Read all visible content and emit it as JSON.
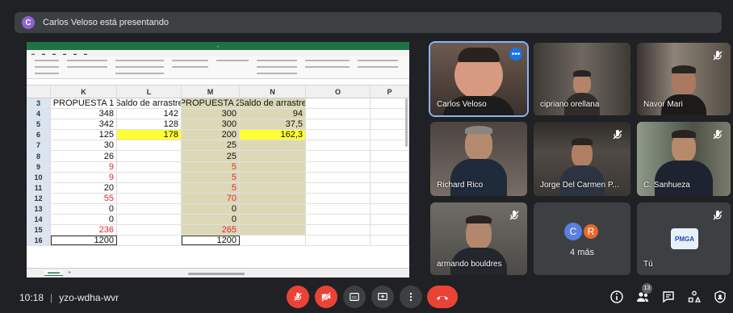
{
  "banner": {
    "avatar_letter": "C",
    "text": "Carlos Veloso está presentando"
  },
  "excel": {
    "columns": [
      "K",
      "L",
      "M",
      "N",
      "O",
      "P"
    ],
    "rows": [
      {
        "n": "3",
        "k": "PROPUESTA 1",
        "l": "Saldo de arrastre",
        "m": "PROPUESTA 2",
        "n2": "Saldo de arrastre"
      },
      {
        "n": "4",
        "k": "348",
        "l": "142",
        "m": "300",
        "n2": "94"
      },
      {
        "n": "5",
        "k": "342",
        "l": "128",
        "m": "300",
        "n2": "37,5"
      },
      {
        "n": "6",
        "k": "125",
        "l": "178",
        "m": "200",
        "n2": "162,3"
      },
      {
        "n": "7",
        "k": "30",
        "l": "",
        "m": "25",
        "n2": ""
      },
      {
        "n": "8",
        "k": "26",
        "l": "",
        "m": "25",
        "n2": ""
      },
      {
        "n": "9",
        "k": "9",
        "l": "",
        "m": "5",
        "n2": ""
      },
      {
        "n": "10",
        "k": "9",
        "l": "",
        "m": "5",
        "n2": ""
      },
      {
        "n": "11",
        "k": "20",
        "l": "",
        "m": "5",
        "n2": ""
      },
      {
        "n": "12",
        "k": "55",
        "l": "",
        "m": "70",
        "n2": ""
      },
      {
        "n": "13",
        "k": "0",
        "l": "",
        "m": "0",
        "n2": ""
      },
      {
        "n": "14",
        "k": "0",
        "l": "",
        "m": "0",
        "n2": ""
      },
      {
        "n": "15",
        "k": "236",
        "l": "",
        "m": "265",
        "n2": ""
      },
      {
        "n": "16",
        "k": "1200",
        "l": "",
        "m": "1200",
        "n2": ""
      }
    ]
  },
  "participants": [
    {
      "name": "Carlos Veloso"
    },
    {
      "name": "cipriano orellana"
    },
    {
      "name": "Navor Mari"
    },
    {
      "name": "Richard Rico"
    },
    {
      "name": "Jorge Del Carmen P..."
    },
    {
      "name": "C. Sanhueza"
    },
    {
      "name": "armando bouldres"
    },
    {
      "name": "4 más",
      "avatars": [
        "C",
        "R"
      ]
    },
    {
      "name": "Tú",
      "logo": "PMGA"
    }
  ],
  "bottom": {
    "time": "10:18",
    "separator": "|",
    "meeting_code": "yzo-wdha-wvr",
    "people_count": "13"
  },
  "colors": {
    "accent": "#1a73e8",
    "red": "#ea4335",
    "yellow_cell": "#ffff33",
    "khaki": "#dcd8b6"
  }
}
